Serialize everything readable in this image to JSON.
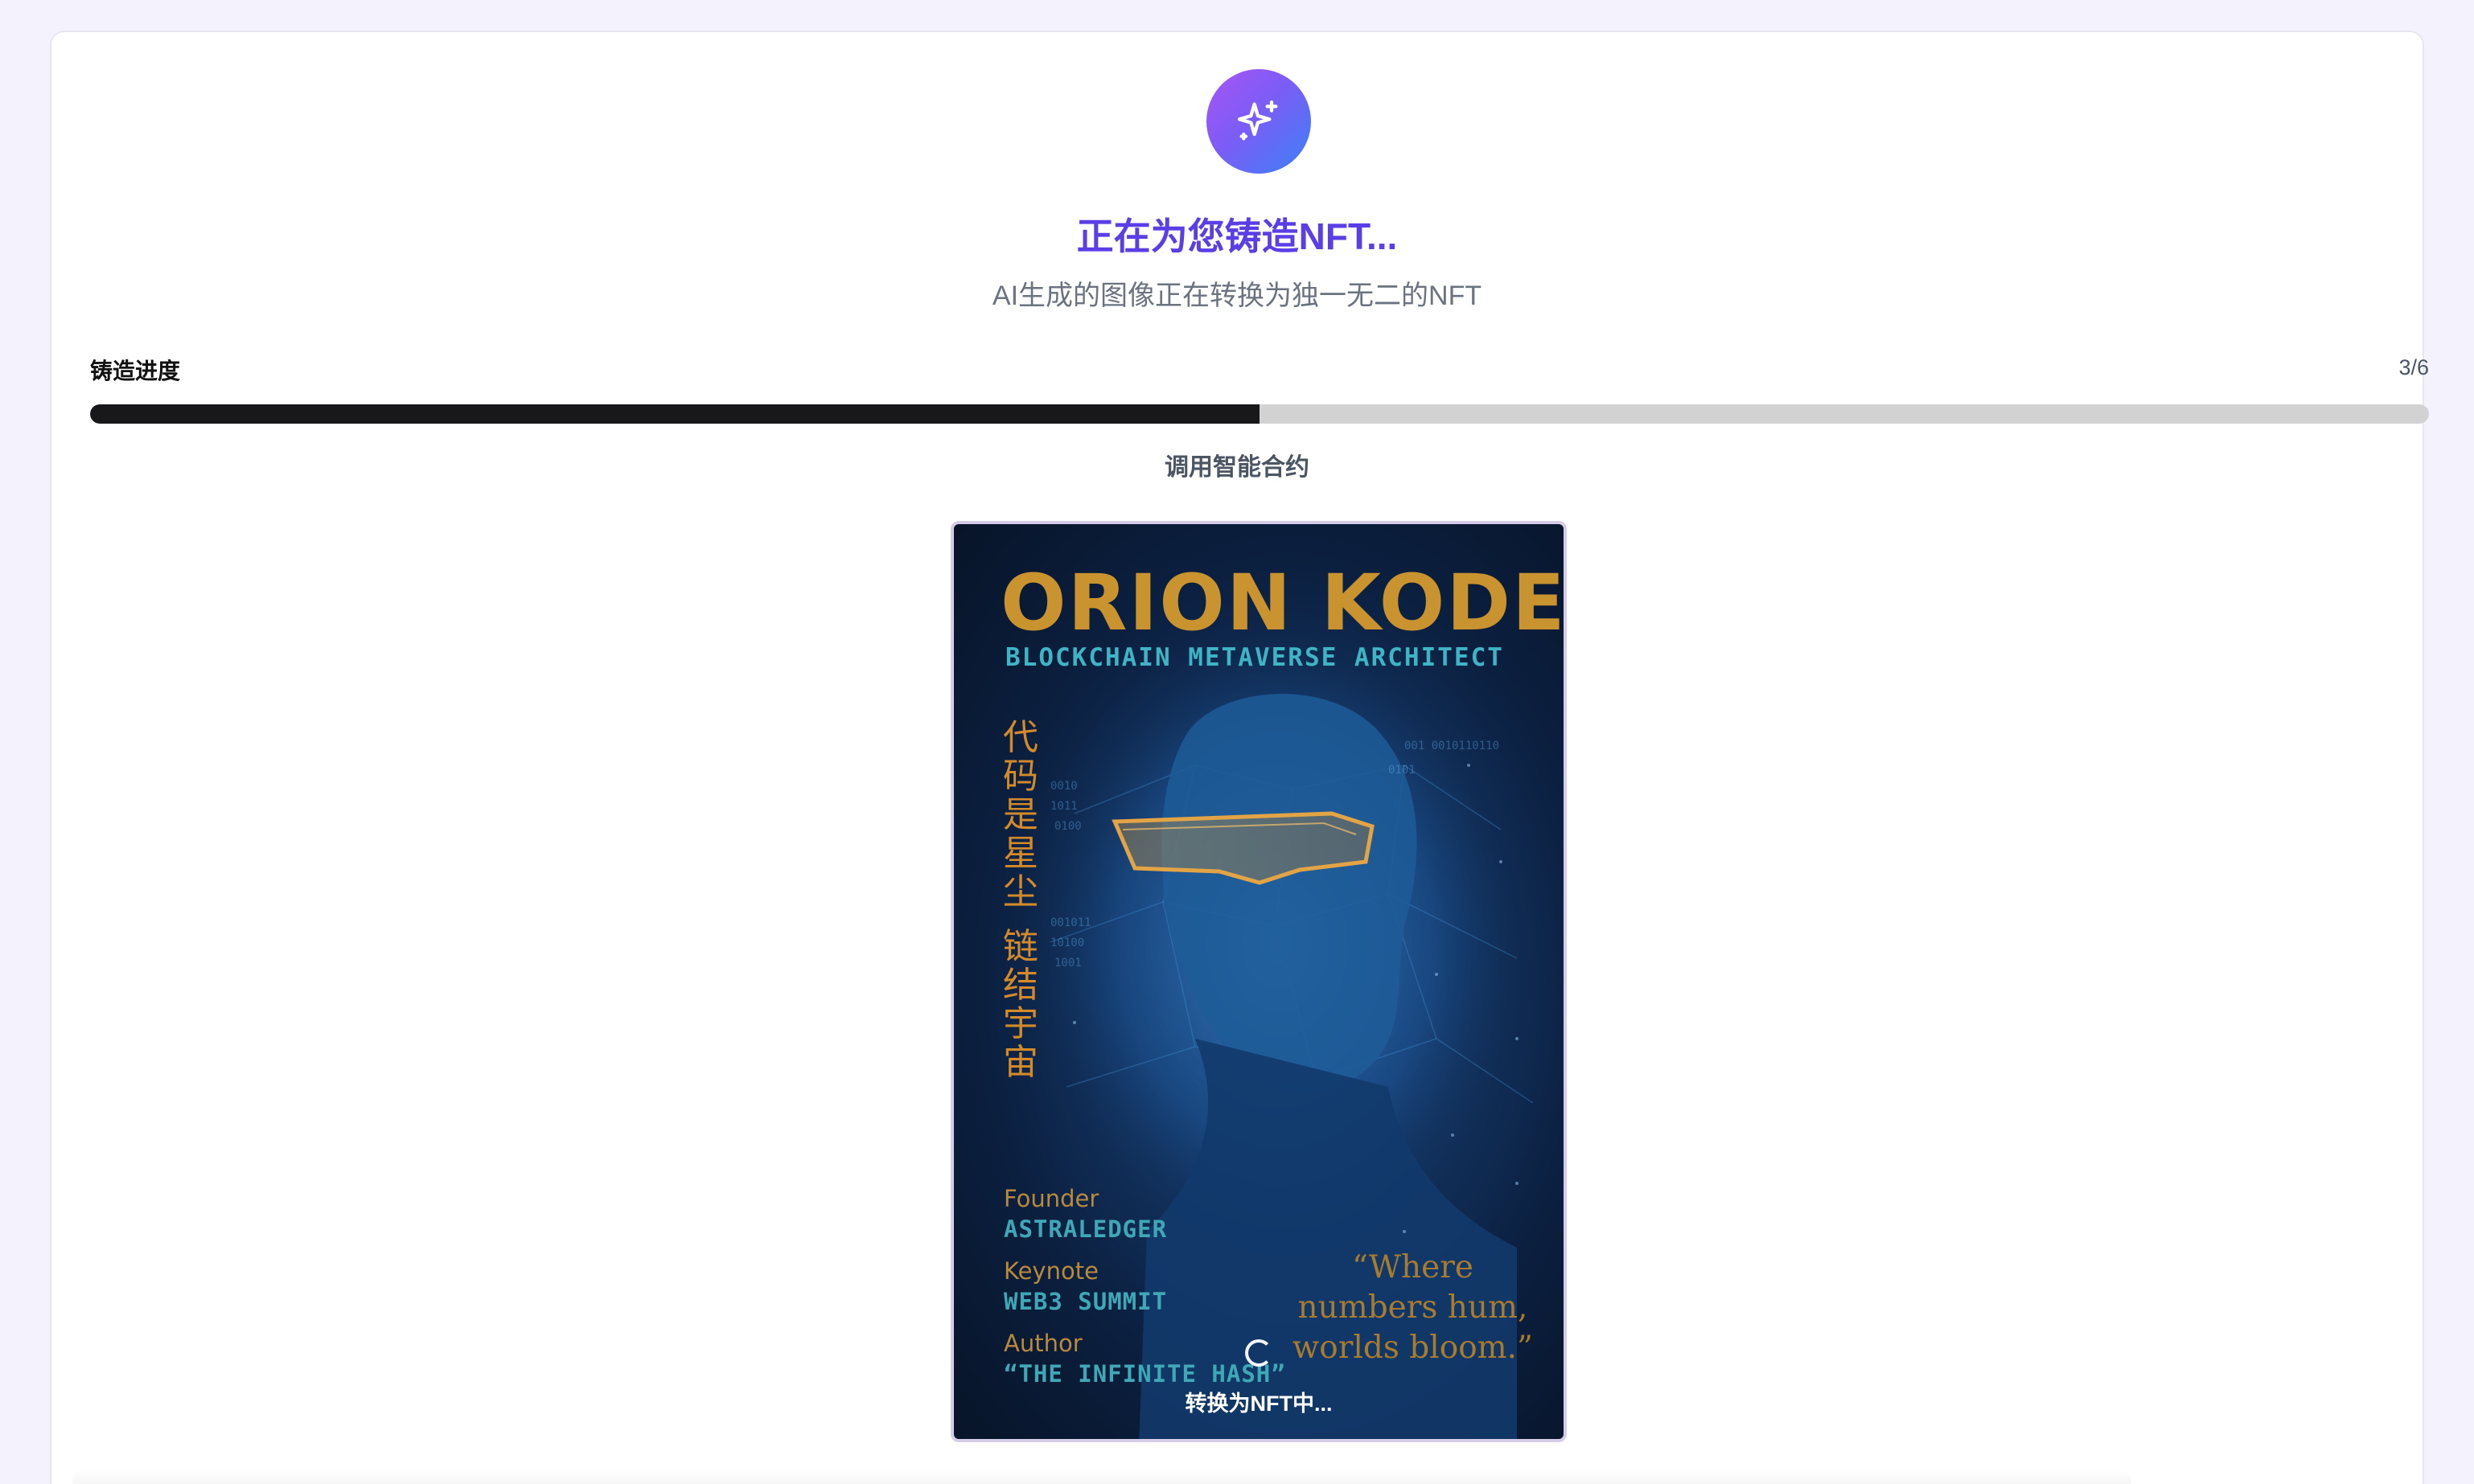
{
  "header": {
    "icon": "sparkles-icon",
    "title": "正在为您铸造NFT...",
    "subtitle": "AI生成的图像正在转换为独一无二的NFT"
  },
  "progress": {
    "label": "铸造进度",
    "count": "3/6",
    "fraction": 0.5,
    "step": "调用智能合约"
  },
  "image": {
    "name": "ORION KODEX",
    "role": "BLOCKCHAIN METAVERSE ARCHITECT",
    "vertical_1": "代码是星尘",
    "vertical_2": "链结宇宙",
    "meta": [
      {
        "key": "Founder",
        "value": "ASTRALEDGER"
      },
      {
        "key": "Keynote",
        "value": "WEB3 SUMMIT"
      },
      {
        "key": "Author",
        "value": "“THE INFINITE HASH”"
      }
    ],
    "quote": "“Where\nnumbers hum,\nworlds bloom.”",
    "status": "转换为NFT中..."
  },
  "colors": {
    "title": "#5b3ee6",
    "progress_fill": "#18181b",
    "progress_track": "#d2d2d2"
  }
}
